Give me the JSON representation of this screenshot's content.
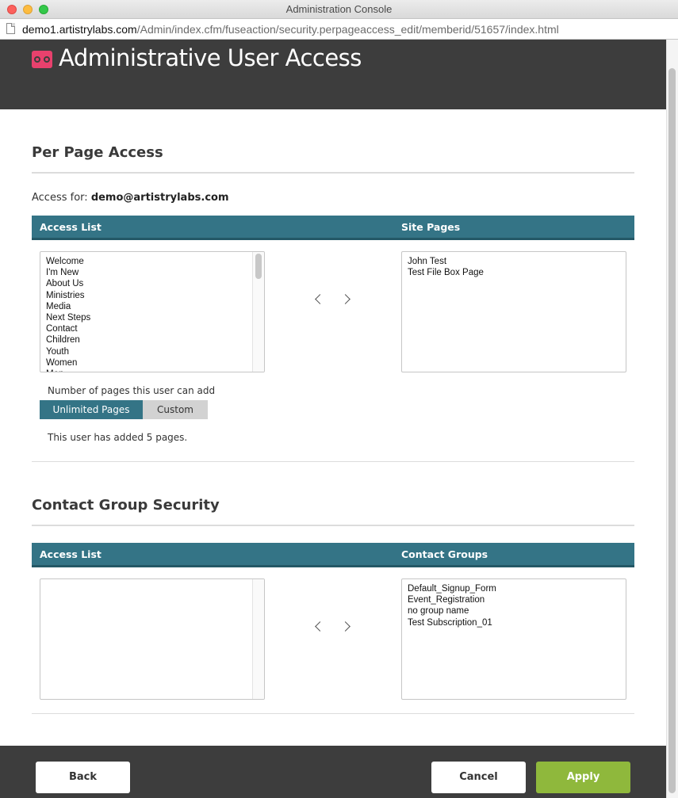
{
  "window": {
    "title": "Administration Console"
  },
  "url": {
    "host": "demo1.artistrylabs.com",
    "path": "/Admin/index.cfm/fuseaction/security.perpageaccess_edit/memberid/51657/index.html"
  },
  "header": {
    "title": "Administrative User Access"
  },
  "per_page_access": {
    "title": "Per Page Access",
    "access_for_label": "Access for:",
    "access_for_email": "demo@artistrylabs.com",
    "left_header": "Access List",
    "right_header": "Site Pages",
    "access_list": [
      "Welcome",
      "I'm New",
      "About Us",
      "Ministries",
      "Media",
      "Next Steps",
      "Contact",
      "Children",
      "Youth",
      "Women",
      "Men"
    ],
    "site_pages": [
      "John Test",
      "Test File Box Page"
    ],
    "pages_label": "Number of pages this user can add",
    "toggle_unlimited": "Unlimited Pages",
    "toggle_custom": "Custom",
    "added_text": "This user has added 5 pages."
  },
  "contact_group_security": {
    "title": "Contact Group Security",
    "left_header": "Access List",
    "right_header": "Contact Groups",
    "access_list": [],
    "contact_groups": [
      "Default_Signup_Form",
      "Event_Registration",
      "no group name",
      "Test Subscription_01"
    ]
  },
  "footer": {
    "back_label": "Back",
    "cancel_label": "Cancel",
    "apply_label": "Apply"
  },
  "colors": {
    "header_bg": "#3d3d3d",
    "accent_teal": "#347486",
    "logo_pink": "#e8416d",
    "apply_green": "#8fb83c"
  }
}
